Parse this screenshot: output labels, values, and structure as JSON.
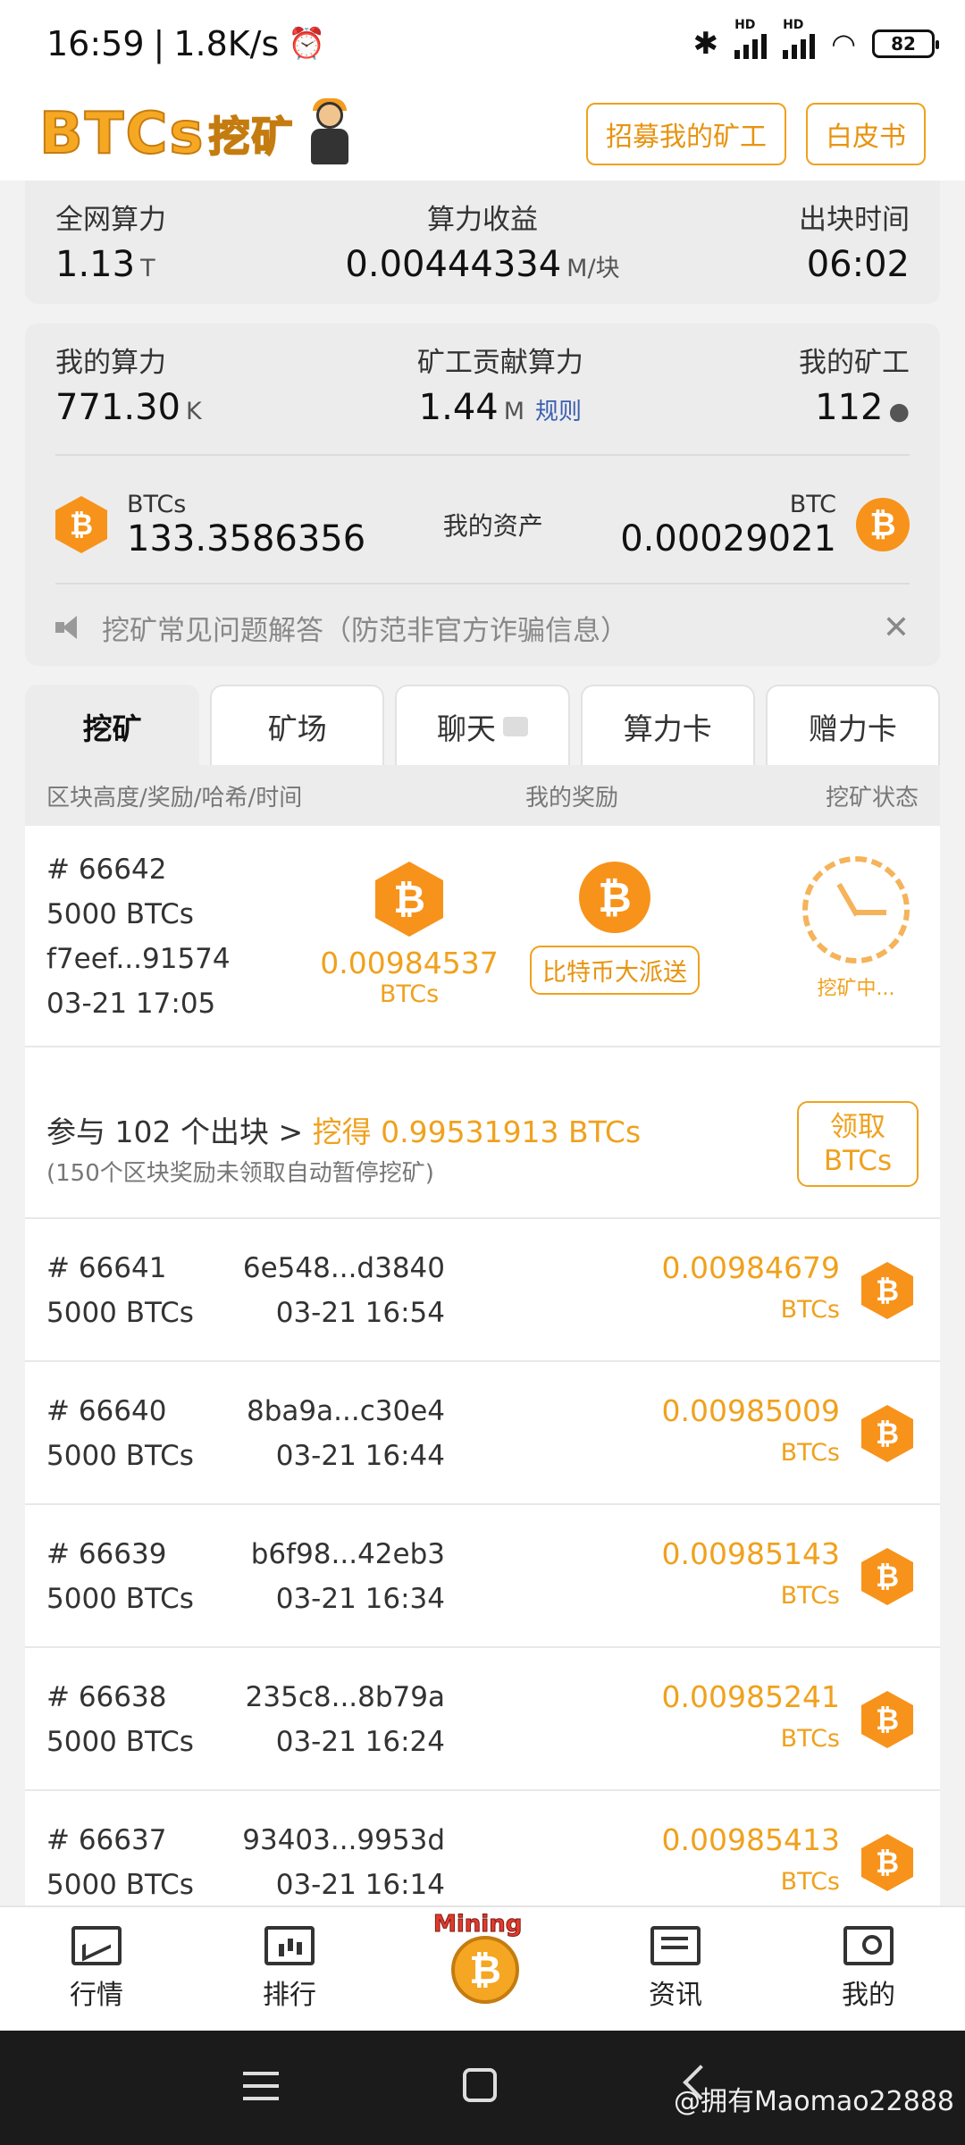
{
  "status_bar": {
    "time": "16:59",
    "speed": "1.8K/s",
    "hd1": "HD",
    "hd2": "HD",
    "battery": "82"
  },
  "header": {
    "logo": "BTCs",
    "logo_cn": "挖矿",
    "btn_recruit": "招募我的矿工",
    "btn_whitepaper": "白皮书"
  },
  "network": {
    "hashrate_label": "全网算力",
    "hashrate_value": "1.13",
    "hashrate_unit": "T",
    "yield_label": "算力收益",
    "yield_value": "0.00444334",
    "yield_unit": "M/块",
    "block_time_label": "出块时间",
    "block_time_value": "06:02"
  },
  "mine": {
    "my_hash_label": "我的算力",
    "my_hash_value": "771.30",
    "my_hash_unit": "K",
    "contrib_label": "矿工贡献算力",
    "contrib_value": "1.44",
    "contrib_unit": "M",
    "rule": "规则",
    "miners_label": "我的矿工",
    "miners_value": "112",
    "btcs_label": "BTCs",
    "btcs_value": "133.3586356",
    "assets_label": "我的资产",
    "btc_label": "BTC",
    "btc_value": "0.00029021",
    "notice": "挖矿常见问题解答（防范非官方诈骗信息）"
  },
  "tabs": [
    "挖矿",
    "矿场",
    "聊天",
    "算力卡",
    "赠力卡"
  ],
  "columns": {
    "left": "区块高度/奖励/哈希/时间",
    "mid": "我的奖励",
    "right": "挖矿状态"
  },
  "current_block": {
    "height": "# 66642",
    "reward": "5000 BTCs",
    "hash": "f7eef...91574",
    "time": "03-21 17:05",
    "my_reward": "0.00984537",
    "my_unit": "BTCs",
    "bonus_btn": "比特币大派送",
    "status": "挖矿中..."
  },
  "claim": {
    "prefix": "参与 102 个出块 > ",
    "got": "挖得 0.99531913 BTCs",
    "note": "(150个区块奖励未领取自动暂停挖矿)",
    "btn_line1": "领取",
    "btn_line2": "BTCs"
  },
  "blocks": [
    {
      "height": "# 66641",
      "reward": "5000 BTCs",
      "hash": "6e548...d3840",
      "time": "03-21 16:54",
      "amount": "0.00984679",
      "unit": "BTCs"
    },
    {
      "height": "# 66640",
      "reward": "5000 BTCs",
      "hash": "8ba9a...c30e4",
      "time": "03-21 16:44",
      "amount": "0.00985009",
      "unit": "BTCs"
    },
    {
      "height": "# 66639",
      "reward": "5000 BTCs",
      "hash": "b6f98...42eb3",
      "time": "03-21 16:34",
      "amount": "0.00985143",
      "unit": "BTCs"
    },
    {
      "height": "# 66638",
      "reward": "5000 BTCs",
      "hash": "235c8...8b79a",
      "time": "03-21 16:24",
      "amount": "0.00985241",
      "unit": "BTCs"
    },
    {
      "height": "# 66637",
      "reward": "5000 BTCs",
      "hash": "93403...9953d",
      "time": "03-21 16:14",
      "amount": "0.00985413",
      "unit": "BTCs"
    }
  ],
  "coin_symbol": "₿",
  "bottom_nav": {
    "market": "行情",
    "rank": "排行",
    "mining": "Mining",
    "news": "资讯",
    "me": "我的"
  },
  "watermark": "@拥有Maomao22888",
  "colors": {
    "accent": "#f0a11d",
    "coin": "#f7931a"
  }
}
